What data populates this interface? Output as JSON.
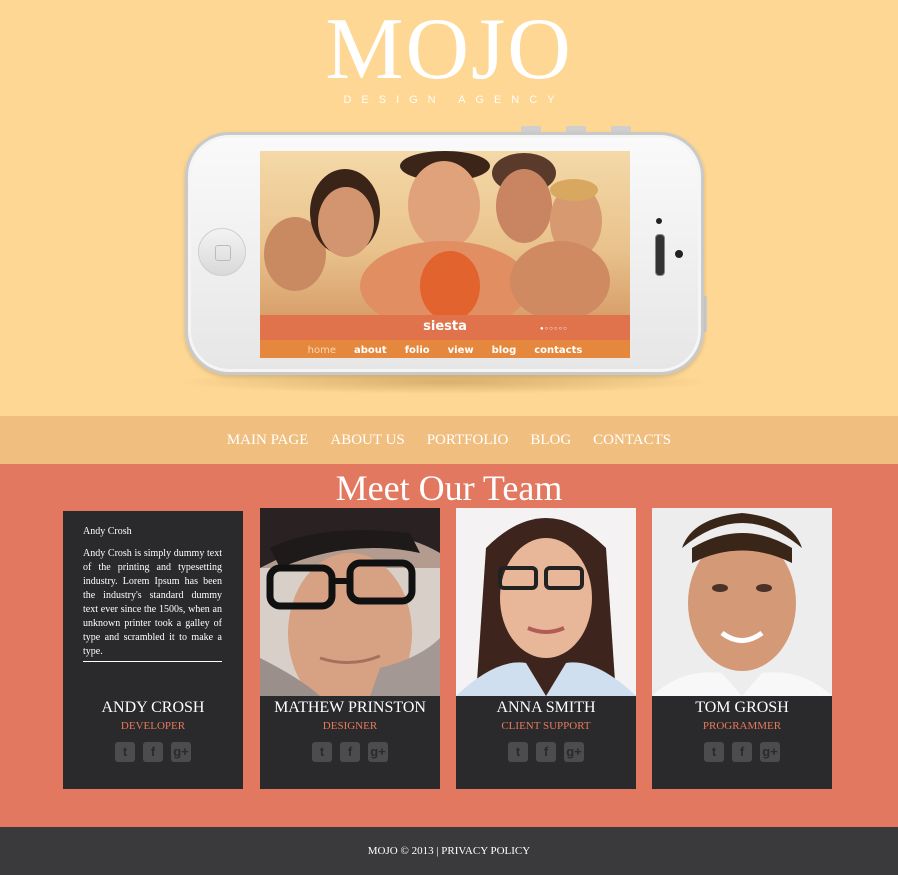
{
  "logo": {
    "main": "MOJO",
    "sub": "DESIGN AGENCY"
  },
  "phone": {
    "siesta": "siesta",
    "nav": [
      "home",
      "about",
      "folio",
      "view",
      "blog",
      "contacts"
    ]
  },
  "nav": [
    "MAIN PAGE",
    "ABOUT US",
    "PORTFOLIO",
    "BLOG",
    "CONTACTS"
  ],
  "team": {
    "title": "Meet Our Team",
    "bio_name": "Andy Crosh",
    "bio_text": "Andy Crosh is simply dummy text of the printing and typesetting industry. Lorem Ipsum has been the industry's standard dummy text ever since the 1500s, when an unknown printer took a galley of type and scrambled it to make a type.",
    "members": [
      {
        "name": "ANDY CROSH",
        "role": "DEVELOPER"
      },
      {
        "name": "MATHEW PRINSTON",
        "role": "DESIGNER"
      },
      {
        "name": "ANNA SMITH",
        "role": "CLIENT SUPPORT"
      },
      {
        "name": "TOM GROSH",
        "role": "PROGRAMMER"
      }
    ],
    "social_icons": [
      "twitter-icon",
      "facebook-icon",
      "google-plus-icon"
    ]
  },
  "footer": {
    "text": "MOJO © 2013 | PRIVACY POLICY"
  },
  "colors": {
    "hero_bg": "#fdd793",
    "nav_bg": "#f0be7e",
    "team_bg": "#e2785f",
    "card_bg": "#2a2a2d",
    "footer_bg": "#3a3a3d",
    "accent": "#e8795c"
  }
}
